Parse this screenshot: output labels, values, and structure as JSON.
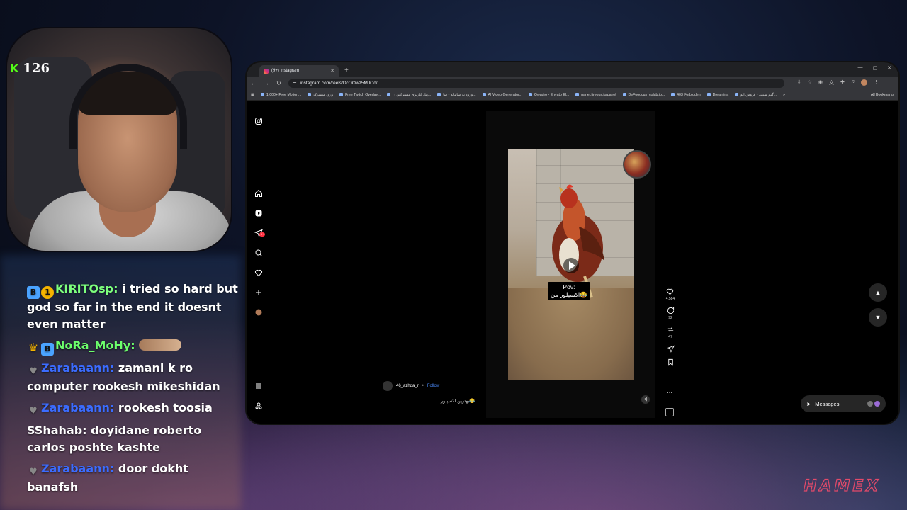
{
  "stream": {
    "viewer_count": "126",
    "brand_logo_text": "HAMEX"
  },
  "chat": [
    {
      "user": "KIRITOsp:",
      "text": "i tried so hard but god so far in the end it doesnt even matter"
    },
    {
      "user": "NoRa_MoHy:",
      "text": ""
    },
    {
      "user": "Zarabaann:",
      "text": "zamani k ro computer rookesh mikeshidan"
    },
    {
      "user": "Zarabaann:",
      "text": "rookesh toosia"
    },
    {
      "user": "SShahab:",
      "text": "doyidane roberto carlos poshte kashte"
    },
    {
      "user": "Zarabaann:",
      "text": "door dokht banafsh"
    }
  ],
  "browser": {
    "tab_title": "(9+) Instagram",
    "url": "instagram.com/reels/DcOOwz5MJOd/",
    "bookmarks": [
      "1,000+ Free Motion...",
      "ورود مشترک",
      "Free Twitch Overlay...",
      "پنل کاربری مشترکین ن...",
      "ورود به سامانه - سا...",
      "AI Video Generator...",
      "Qwadro - Envato El...",
      "panel.fireops.io/panel",
      "DeFooocus_colab.ip...",
      "403 Forbidden",
      "Dreamina",
      "گیم شیتی - فروش انو..."
    ],
    "all_bookmarks": "All Bookmarks"
  },
  "instagram": {
    "notif_badge": "9+",
    "caption_line1": "Pov:",
    "caption_line2": "اکسپلور من😂",
    "author": "46_azhda_r",
    "follow": "Follow",
    "description": "بهترین اکسپلور😂",
    "likes": "4,584",
    "comments": "92",
    "reposts": "47",
    "messages_label": "Messages"
  },
  "colors": {
    "kick_green": "#53fc18",
    "ig_link_blue": "#4c8dff",
    "logo_pink": "#e24a6a"
  }
}
